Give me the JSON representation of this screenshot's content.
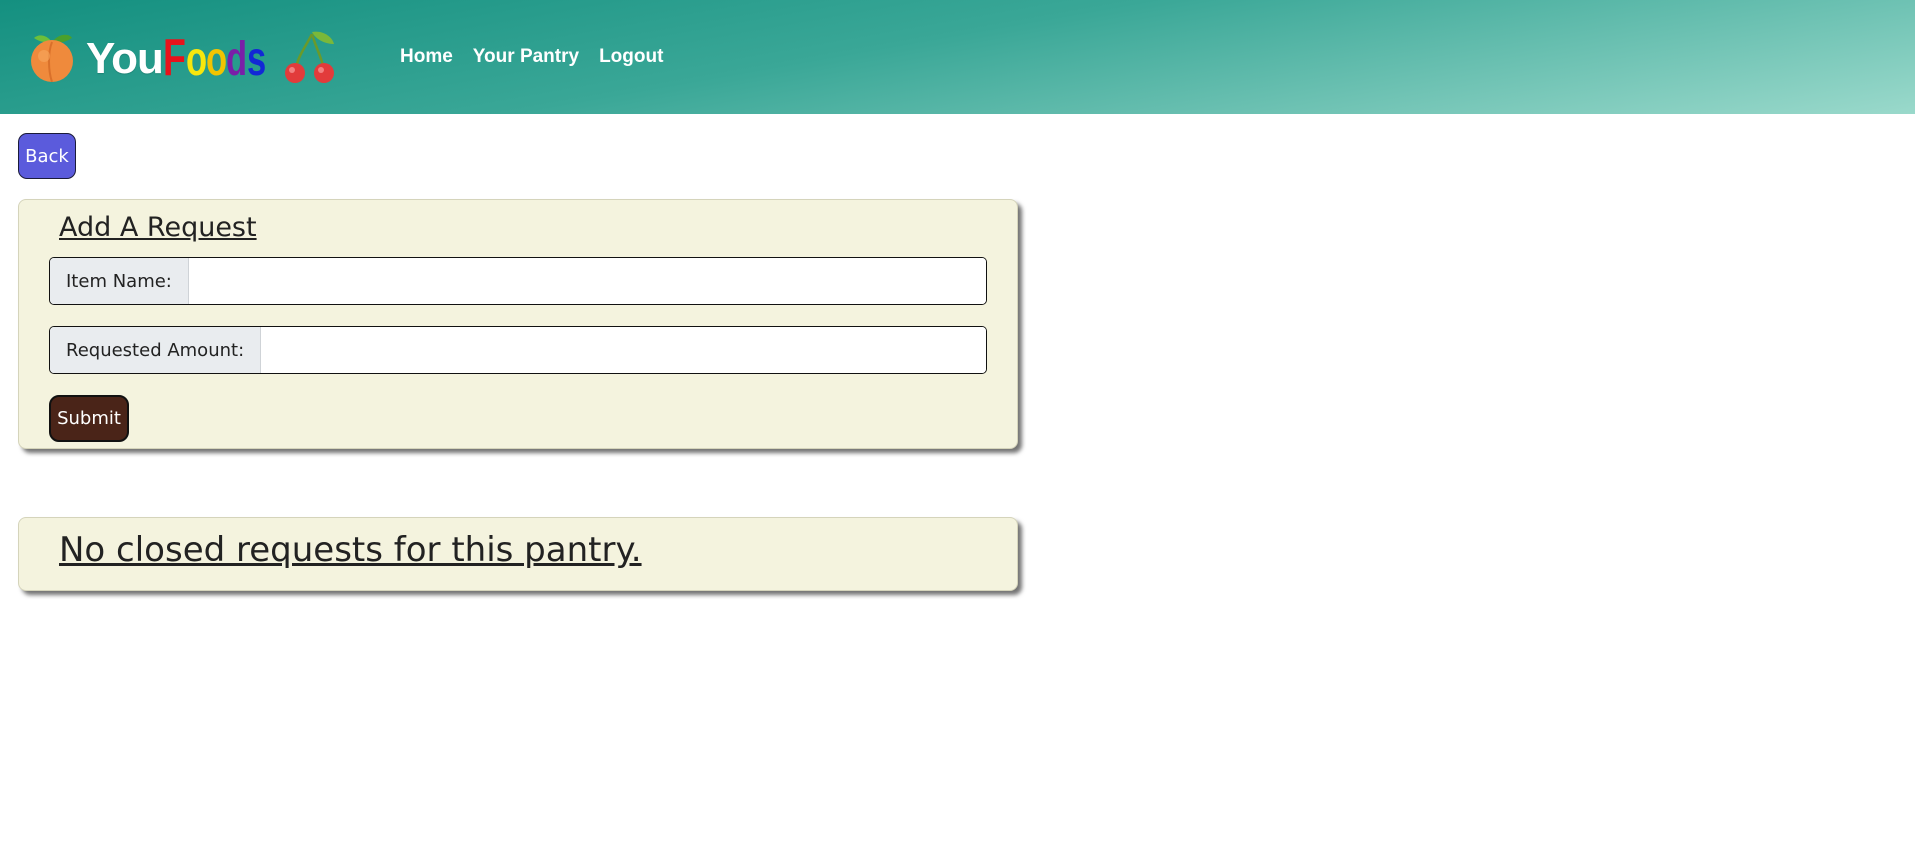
{
  "header": {
    "brand": {
      "you": "You",
      "foods_letters": [
        {
          "char": "F",
          "color": "#e8121b"
        },
        {
          "char": "o",
          "color": "#f7e70d"
        },
        {
          "char": "o",
          "color": "#f2c400"
        },
        {
          "char": "d",
          "color": "#7a1fa8"
        },
        {
          "char": "s",
          "color": "#1228d6"
        }
      ],
      "left_icon": "peach-icon",
      "right_icon": "cherries-icon"
    },
    "nav": [
      {
        "label": "Home"
      },
      {
        "label": "Your Pantry"
      },
      {
        "label": "Logout"
      }
    ],
    "colors": {
      "gradient_start": "#149080",
      "gradient_end": "#9ad9cb"
    }
  },
  "back_button": {
    "label": "Back",
    "color": "#5b5bdc"
  },
  "request_form": {
    "title": "Add A Request",
    "item_name": {
      "label": "Item Name:",
      "value": ""
    },
    "requested_amount": {
      "label": "Requested Amount:",
      "value": ""
    },
    "submit_label": "Submit",
    "submit_color": "#4a2418",
    "card_color": "#f4f3de"
  },
  "closed_requests": {
    "message": "No closed requests for this pantry."
  }
}
